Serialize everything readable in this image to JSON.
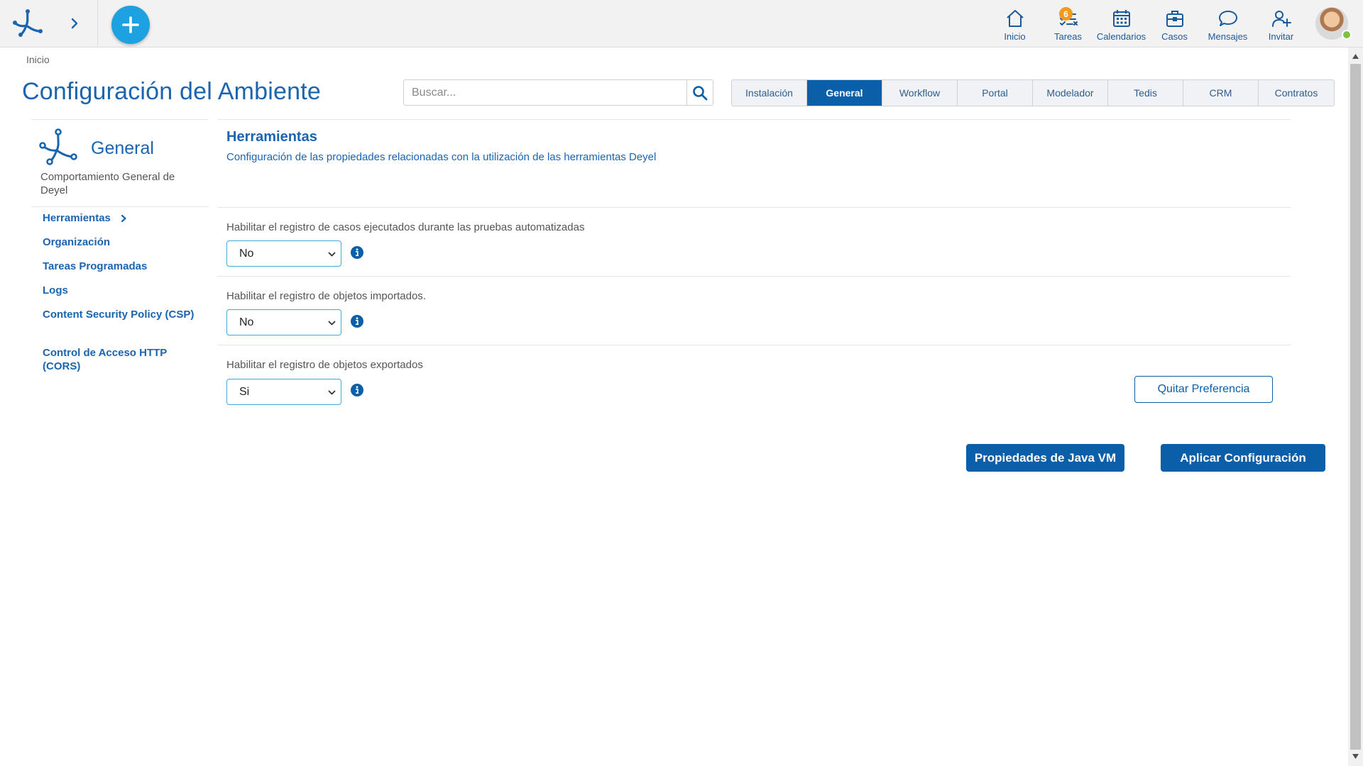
{
  "topbar": {
    "nav": [
      {
        "key": "inicio",
        "label": "Inicio",
        "icon": "home-icon"
      },
      {
        "key": "tareas",
        "label": "Tareas",
        "icon": "tasks-icon",
        "badge": "6"
      },
      {
        "key": "calendarios",
        "label": "Calendarios",
        "icon": "calendar-icon"
      },
      {
        "key": "casos",
        "label": "Casos",
        "icon": "briefcase-icon"
      },
      {
        "key": "mensajes",
        "label": "Mensajes",
        "icon": "chat-bubble-icon"
      },
      {
        "key": "invitar",
        "label": "Invitar",
        "icon": "add-user-icon"
      }
    ],
    "status_color": "#7dc242"
  },
  "breadcrumb": "Inicio",
  "page_title": "Configuración del Ambiente",
  "search": {
    "placeholder": "Buscar..."
  },
  "tabs": [
    {
      "label": "Instalación",
      "active": false
    },
    {
      "label": "General",
      "active": true
    },
    {
      "label": "Workflow",
      "active": false
    },
    {
      "label": "Portal",
      "active": false
    },
    {
      "label": "Modelador",
      "active": false
    },
    {
      "label": "Tedis",
      "active": false
    },
    {
      "label": "CRM",
      "active": false
    },
    {
      "label": "Contratos",
      "active": false
    }
  ],
  "sidebar": {
    "section_name": "General",
    "section_description": "Comportamiento General de Deyel",
    "items": [
      {
        "label": "Herramientas",
        "selected": true
      },
      {
        "label": "Organización"
      },
      {
        "label": "Tareas Programadas"
      },
      {
        "label": "Logs"
      },
      {
        "label": "Content Security Policy (CSP)"
      },
      {
        "label": "Control de Acceso HTTP (CORS)"
      }
    ]
  },
  "content": {
    "title": "Herramientas",
    "description": "Configuración de las propiedades relacionadas con la utilización de las herramientas Deyel",
    "fields": [
      {
        "label": "Habilitar el registro de casos ejecutados durante las pruebas automatizadas",
        "value": "No"
      },
      {
        "label": "Habilitar el registro de objetos importados.",
        "value": "No"
      },
      {
        "label": "Habilitar el registro de objetos exportados",
        "value": "Si"
      }
    ],
    "remove_preference_label": "Quitar Preferencia"
  },
  "actions": {
    "java_vm_label": "Propiedades de Java VM",
    "apply_label": "Aplicar Configuración"
  },
  "colors": {
    "brand_blue": "#0b5ea8",
    "title_blue": "#1a64b0",
    "accent_cyan": "#1ea1e0",
    "badge_orange": "#f19a1e"
  }
}
